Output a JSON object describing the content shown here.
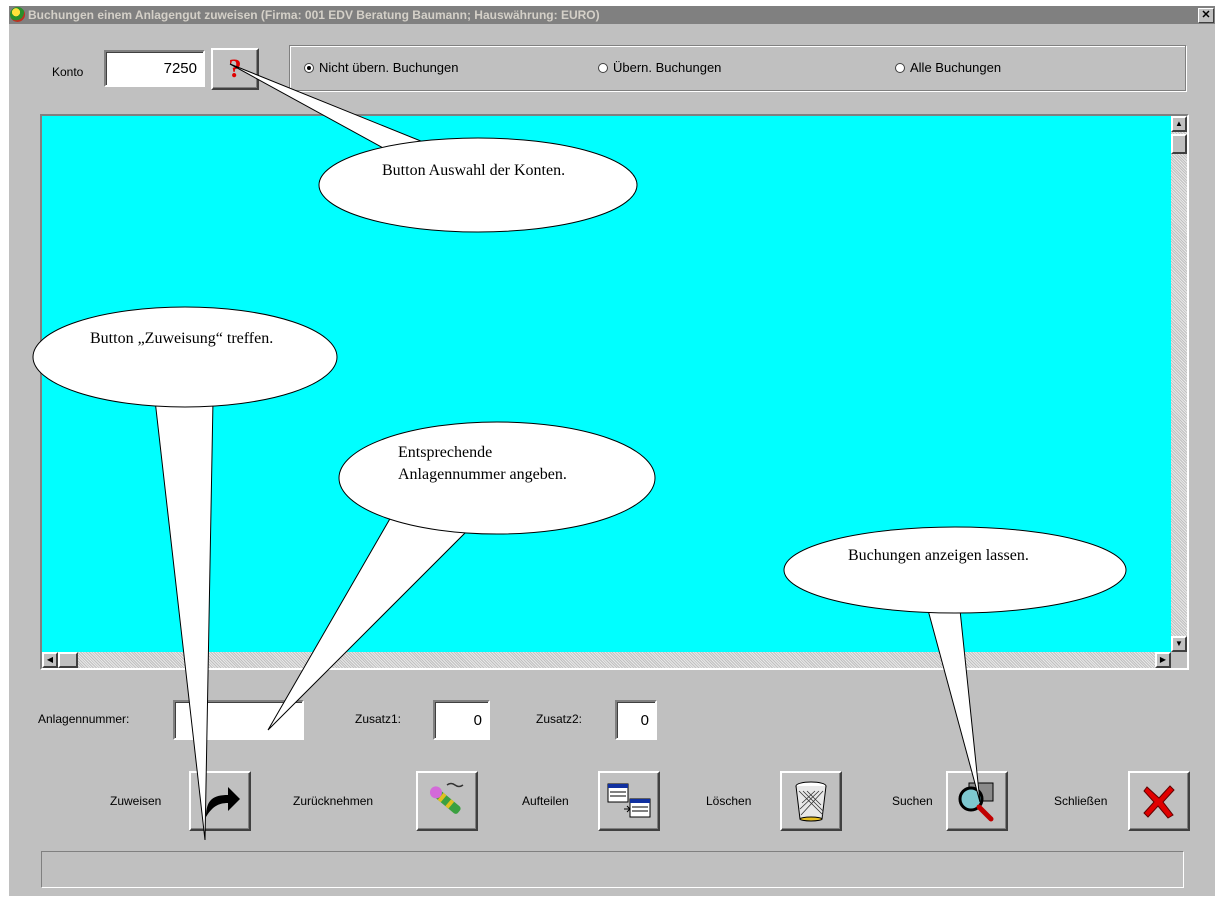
{
  "window": {
    "title": "Buchungen einem Anlagengut zuweisen  (Firma: 001 EDV Beratung Baumann;   Hauswährung: EURO)",
    "close_glyph": "✕"
  },
  "konto": {
    "label": "Konto",
    "value": "7250",
    "help_glyph": "?"
  },
  "filter": {
    "options": [
      {
        "label": "Nicht übern. Buchungen",
        "selected": true
      },
      {
        "label": "Übern. Buchungen",
        "selected": false
      },
      {
        "label": "Alle Buchungen",
        "selected": false
      }
    ]
  },
  "fields": {
    "anlagennummer": {
      "label": "Anlagennummer:",
      "value": ""
    },
    "zusatz1": {
      "label": "Zusatz1:",
      "value": "0"
    },
    "zusatz2": {
      "label": "Zusatz2:",
      "value": "0"
    }
  },
  "actions": {
    "zuweisen": "Zuweisen",
    "zuruecknehmen": "Zurücknehmen",
    "aufteilen": "Aufteilen",
    "loeschen": "Löschen",
    "suchen": "Suchen",
    "schliessen": "Schließen"
  },
  "callouts": {
    "konten": "Button Auswahl der Konten.",
    "zuweisung": "Button „Zuweisung“ treffen.",
    "anlagennummer": "Entsprechende Anlagennummer angeben.",
    "buchungen": "Buchungen anzeigen lassen."
  },
  "colors": {
    "grid_background": "#00ffff",
    "window_face": "#c0c0c0",
    "titlebar": "#808080"
  },
  "icons": {
    "help": "question-mark-icon",
    "zuweisen": "curved-arrow-icon",
    "zuruecknehmen": "undo-pen-icon",
    "aufteilen": "split-tables-icon",
    "loeschen": "trash-basket-icon",
    "suchen": "magnifier-icon",
    "schliessen": "red-x-icon"
  }
}
